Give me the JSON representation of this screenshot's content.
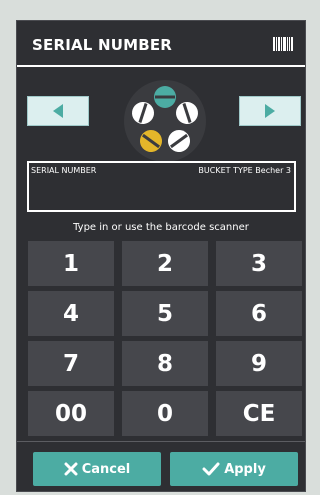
{
  "dialog": {
    "title": "SERIAL NUMBER",
    "title_icon": "barcode-icon"
  },
  "navigation": {
    "prev_icon": "arrow-left-icon",
    "next_icon": "arrow-right-icon"
  },
  "bucket": {
    "icon": "bucket-type-icon",
    "colors": {
      "top": "#4caca3",
      "left_bottom": "#e3b62a",
      "white": "#ffffff",
      "bg": "#3a3b3f"
    }
  },
  "info": {
    "serial_label": "SERIAL NUMBER",
    "bucket_type_label": "BUCKET TYPE Becher 3"
  },
  "hint": "Type in or use the barcode scanner",
  "keypad": {
    "keys": [
      "1",
      "2",
      "3",
      "4",
      "5",
      "6",
      "7",
      "8",
      "9",
      "00",
      "0",
      "CE"
    ]
  },
  "actions": {
    "cancel_label": "Cancel",
    "cancel_icon": "close-icon",
    "apply_label": "Apply",
    "apply_icon": "check-icon"
  },
  "colors": {
    "dialog_bg": "#2e2f33",
    "key_bg": "#46474c",
    "accent": "#4caca3",
    "nav_bg": "#dcefef",
    "nav_arrow": "#4caca3"
  }
}
